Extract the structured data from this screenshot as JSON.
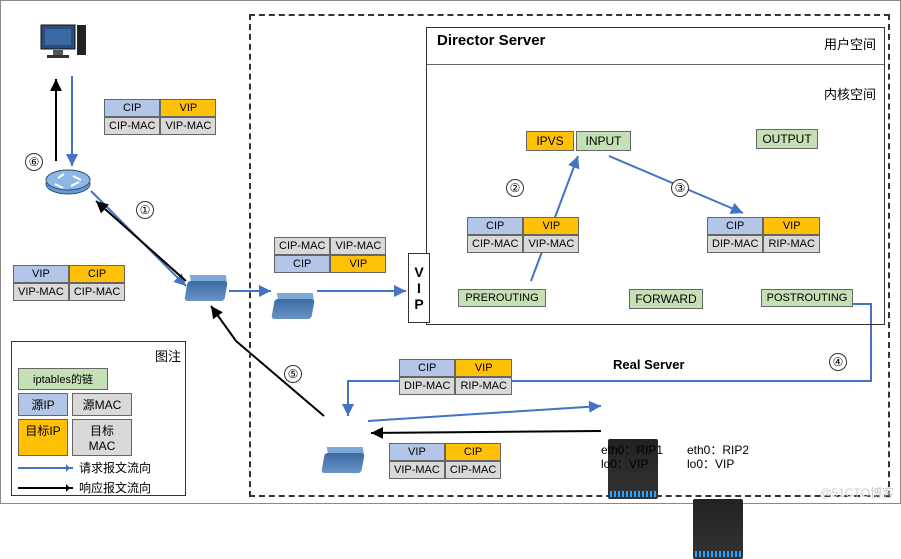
{
  "director": {
    "title": "Director Server",
    "user_space": "用户空间",
    "kernel_space": "内核空间"
  },
  "chains": {
    "ipvs": "IPVS",
    "input": "INPUT",
    "output": "OUTPUT",
    "prerouting": "PREROUTING",
    "forward": "FORWARD",
    "postrouting": "POSTROUTING"
  },
  "pkt": {
    "cip": "CIP",
    "vip": "VIP",
    "cip_mac": "CIP-MAC",
    "vip_mac": "VIP-MAC",
    "dip_mac": "DIP-MAC",
    "rip_mac": "RIP-MAC"
  },
  "steps": {
    "s1": "①",
    "s2": "②",
    "s3": "③",
    "s4": "④",
    "s5": "⑤",
    "s6": "⑥"
  },
  "vip_label": "VIP",
  "real_server": {
    "title": "Real Server",
    "rs1": {
      "eth": "eth0：RIP1",
      "lo": "lo0：VIP"
    },
    "rs2": {
      "eth": "eth0：RIP2",
      "lo": "lo0：VIP"
    }
  },
  "legend": {
    "title": "图注",
    "chain": "iptables的链",
    "src_ip": "源IP",
    "src_mac": "源MAC",
    "dst_ip": "目标IP",
    "dst_mac": "目标MAC",
    "req_flow": "请求报文流向",
    "resp_flow": "响应报文流向"
  },
  "watermark": "@51CTO博客"
}
